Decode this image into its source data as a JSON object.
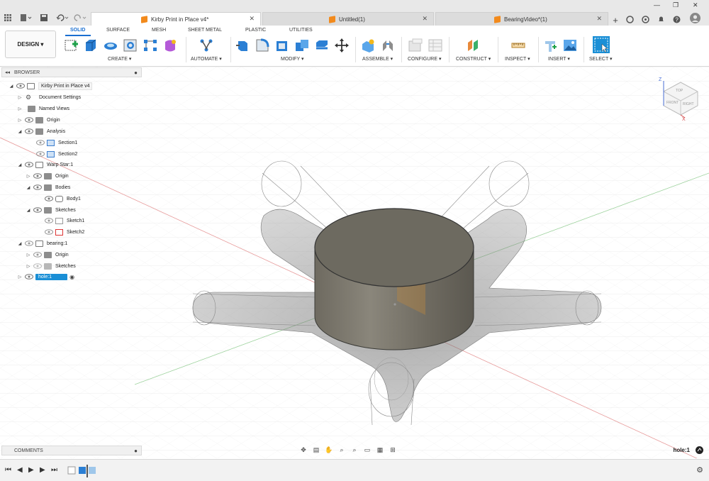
{
  "tabs": [
    {
      "label": "Kirby Print in Place v4*",
      "active": true
    },
    {
      "label": "Untitled(1)",
      "active": false
    },
    {
      "label": "BearingVideo*(1)",
      "active": false
    }
  ],
  "ribbon": {
    "workspace": "DESIGN ▾",
    "tabs": [
      "SOLID",
      "SURFACE",
      "MESH",
      "SHEET METAL",
      "PLASTIC",
      "UTILITIES"
    ],
    "active_tab": "SOLID",
    "groups": [
      "CREATE ▾",
      "AUTOMATE ▾",
      "MODIFY ▾",
      "ASSEMBLE ▾",
      "CONFIGURE ▾",
      "CONSTRUCT ▾",
      "INSPECT ▾",
      "INSERT ▾",
      "SELECT ▾"
    ]
  },
  "browser": {
    "title": "BROWSER",
    "tree": [
      {
        "label": "Kirby Print in Place v4",
        "kind": "root"
      },
      {
        "label": "Document Settings",
        "kind": "gear"
      },
      {
        "label": "Named Views",
        "kind": "folder"
      },
      {
        "label": "Origin",
        "kind": "folder"
      },
      {
        "label": "Analysis",
        "kind": "folder"
      },
      {
        "label": "Section1",
        "kind": "section"
      },
      {
        "label": "Section2",
        "kind": "section"
      },
      {
        "label": "Warp Star:1",
        "kind": "component"
      },
      {
        "label": "Origin",
        "kind": "folder"
      },
      {
        "label": "Bodies",
        "kind": "folder"
      },
      {
        "label": "Body1",
        "kind": "body"
      },
      {
        "label": "Sketches",
        "kind": "folder"
      },
      {
        "label": "Sketch1",
        "kind": "sketch"
      },
      {
        "label": "Sketch2",
        "kind": "sketch"
      },
      {
        "label": "bearing:1",
        "kind": "component"
      },
      {
        "label": "Origin",
        "kind": "folder"
      },
      {
        "label": "Sketches",
        "kind": "folder"
      },
      {
        "label": "hole:1",
        "kind": "component",
        "selected": true
      }
    ]
  },
  "viewcube": {
    "top": "TOP",
    "front": "FRONT",
    "right": "RIGHT",
    "axis_z": "Z",
    "axis_x": "X"
  },
  "comments": {
    "title": "COMMENTS"
  },
  "status": {
    "selection": "hole:1"
  },
  "colors": {
    "accent": "#1a6fd1",
    "selection": "#1a8fd6",
    "orange": "#f28a1c"
  }
}
